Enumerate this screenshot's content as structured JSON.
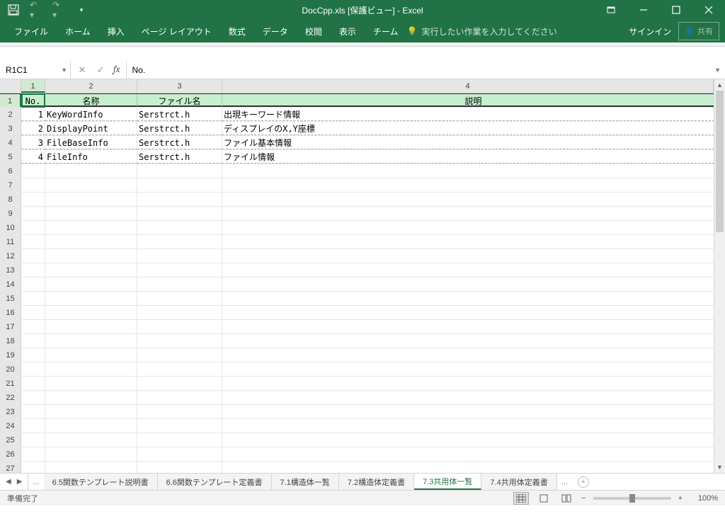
{
  "title": "DocCpp.xls  [保護ビュー] - Excel",
  "qa": {
    "save": "保存",
    "undo": "元に戻す",
    "redo": "やり直し"
  },
  "ribbon": {
    "tabs": [
      "ファイル",
      "ホーム",
      "挿入",
      "ページ レイアウト",
      "数式",
      "データ",
      "校閲",
      "表示",
      "チーム"
    ],
    "tellme": "実行したい作業を入力してください",
    "signin": "サインイン",
    "share": "共有"
  },
  "namebox": "R1C1",
  "formula": "No.",
  "columns": [
    "1",
    "2",
    "3",
    "4"
  ],
  "headers": {
    "c1": "No.",
    "c2": "名称",
    "c3": "ファイル名",
    "c4": "説明"
  },
  "data_rows": [
    {
      "no": "1",
      "name": "KeyWordInfo",
      "file": "Serstrct.h",
      "desc": "出現キーワード情報"
    },
    {
      "no": "2",
      "name": "DisplayPoint",
      "file": "Serstrct.h",
      "desc": "ディスプレイのX,Y座標"
    },
    {
      "no": "3",
      "name": "FileBaseInfo",
      "file": "Serstrct.h",
      "desc": "ファイル基本情報"
    },
    {
      "no": "4",
      "name": "FileInfo",
      "file": "Serstrct.h",
      "desc": "ファイル情報"
    }
  ],
  "row_count": 27,
  "sheet_tabs": [
    "6.5関数テンプレート説明書",
    "6.6関数テンプレート定義書",
    "7.1構造体一覧",
    "7.2構造体定義書",
    "7.3共用体一覧",
    "7.4共用体定義書"
  ],
  "active_sheet": 4,
  "status": "準備完了",
  "zoom": "100%"
}
